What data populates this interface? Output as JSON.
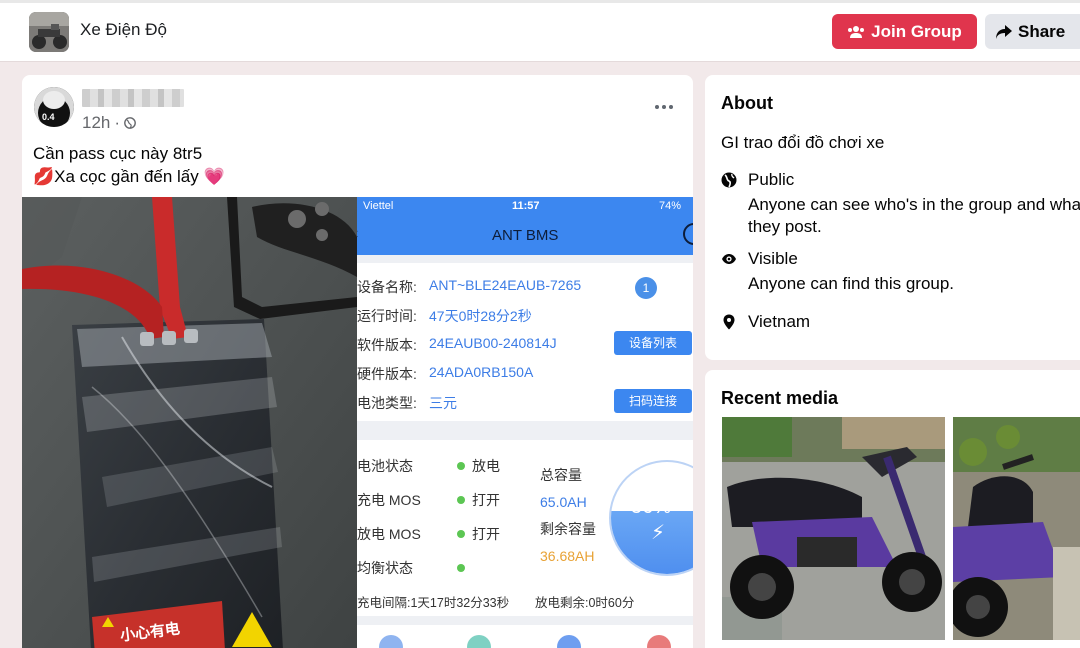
{
  "header": {
    "group_name": "Xe Điện Độ",
    "join_label": "Join Group",
    "share_label": "Share"
  },
  "post": {
    "time": "12h",
    "time_sep": "·",
    "line1": "Cần pass cục này 8tr5",
    "line2": "💋Xa cọc gần đến lấy 💗",
    "battery_warning": "小心有电",
    "app": {
      "carrier": "Viettel",
      "clock": "11:57",
      "battery": "74%",
      "title": "ANT BMS",
      "info_rows": [
        {
          "key": "设备名称:",
          "value": "ANT~BLE24EAUB-7265"
        },
        {
          "key": "运行时间:",
          "value": "47天0时28分2秒"
        },
        {
          "key": "软件版本:",
          "value": "24EAUB00-240814J"
        },
        {
          "key": "硬件版本:",
          "value": "24ADA0RB150A"
        },
        {
          "key": "电池类型:",
          "value": "三元"
        }
      ],
      "badge": "1",
      "device_list_btn": "设备列表",
      "scan_btn": "扫码连接",
      "status_rows": [
        {
          "key": "电池状态",
          "value": "放电"
        },
        {
          "key": "充电 MOS",
          "value": "打开"
        },
        {
          "key": "放电 MOS",
          "value": "打开"
        },
        {
          "key": "均衡状态",
          "value": ""
        }
      ],
      "total_cap_label": "总容量",
      "total_cap_value": "65.0AH",
      "remain_cap_label": "剩余容量",
      "remain_cap_value": "36.68AH",
      "percent": "56%",
      "percent_value": 56,
      "charge_interval": "充电间隔:1天17时32分33秒",
      "discharge_remaining": "放电剩余:0时60分"
    }
  },
  "about": {
    "title": "About",
    "description": "GI trao đổi đồ chơi xe",
    "items": [
      {
        "icon": "globe-icon",
        "title": "Public",
        "sub": "Anyone can see who's in the group and what they post."
      },
      {
        "icon": "eye-icon",
        "title": "Visible",
        "sub": "Anyone can find this group."
      },
      {
        "icon": "location-pin-icon",
        "title": "Vietnam",
        "sub": ""
      }
    ]
  },
  "media": {
    "title": "Recent media"
  },
  "colors": {
    "join_red": "#e0354d",
    "app_blue": "#3c87f0",
    "page_bg": "#f2e9ea"
  }
}
